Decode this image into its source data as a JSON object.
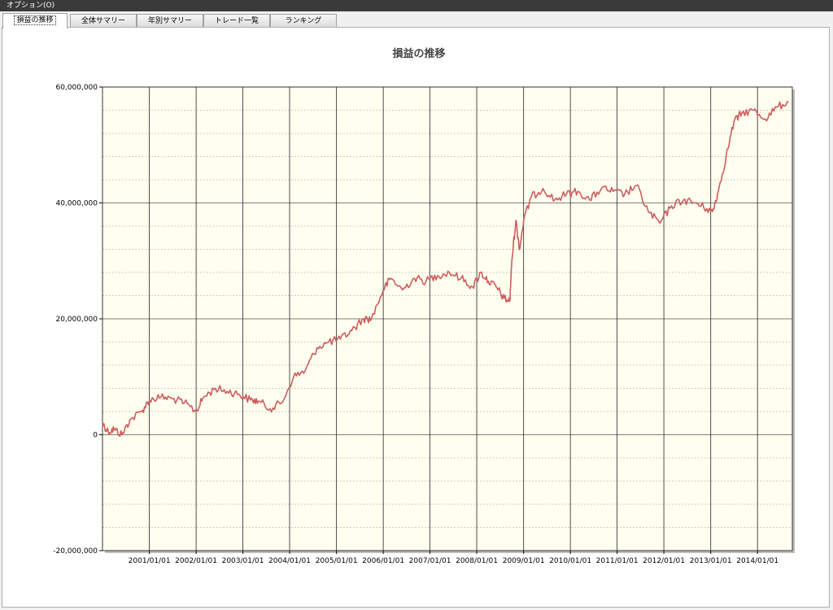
{
  "menubar": {
    "label": "オプション(O)"
  },
  "tabs": [
    {
      "label": "損益の推移",
      "active": true
    },
    {
      "label": "全体サマリー",
      "active": false
    },
    {
      "label": "年別サマリー",
      "active": false
    },
    {
      "label": "トレード一覧",
      "active": false
    },
    {
      "label": "ランキング",
      "active": false
    }
  ],
  "colors": {
    "plot_bg": "#fffff0",
    "line": "#cd5c5c",
    "grid_major": "#555555",
    "grid_minor": "#9a9a9a"
  },
  "chart_data": {
    "type": "line",
    "title": "損益の推移",
    "xlabel": "",
    "ylabel": "",
    "xlim": [
      "2000-01-01",
      "2014-09-30"
    ],
    "ylim": [
      -20000000,
      60000000
    ],
    "x_ticks": [
      "2001/01/01",
      "2002/01/01",
      "2003/01/01",
      "2004/01/01",
      "2005/01/01",
      "2006/01/01",
      "2007/01/01",
      "2008/01/01",
      "2009/01/01",
      "2010/01/01",
      "2011/01/01",
      "2012/01/01",
      "2013/01/01",
      "2014/01/01"
    ],
    "y_ticks": [
      "60,000,000",
      "40,000,000",
      "20,000,000",
      "0",
      "-20,000,000"
    ],
    "grid": true,
    "series": [
      {
        "x": [
          "2000-01-01",
          "2000-02-15",
          "2000-04-01",
          "2000-06-01",
          "2000-08-01",
          "2000-11-01",
          "2001-01-01",
          "2001-04-01",
          "2001-07-01",
          "2001-10-01",
          "2002-01-01",
          "2002-03-01",
          "2002-06-01",
          "2002-09-01",
          "2002-12-01",
          "2003-03-01",
          "2003-05-01",
          "2003-08-01",
          "2003-11-01",
          "2004-02-01",
          "2004-05-01",
          "2004-08-01",
          "2004-11-01",
          "2005-02-01",
          "2005-05-01",
          "2005-08-01",
          "2005-10-01",
          "2006-01-01",
          "2006-03-01",
          "2006-06-01",
          "2006-09-01",
          "2006-12-01",
          "2007-03-01",
          "2007-06-01",
          "2007-09-01",
          "2007-12-01",
          "2008-02-01",
          "2008-04-01",
          "2008-06-01",
          "2008-08-01",
          "2008-09-15",
          "2008-10-01",
          "2008-11-01",
          "2008-12-01",
          "2009-01-01",
          "2009-03-01",
          "2009-06-01",
          "2009-09-01",
          "2009-12-01",
          "2010-03-01",
          "2010-06-01",
          "2010-09-01",
          "2010-12-01",
          "2011-03-01",
          "2011-06-01",
          "2011-09-01",
          "2011-12-01",
          "2012-03-01",
          "2012-06-01",
          "2012-09-01",
          "2012-12-01",
          "2013-01-15",
          "2013-03-01",
          "2013-05-01",
          "2013-07-01",
          "2013-09-01",
          "2013-12-01",
          "2014-03-01",
          "2014-06-01",
          "2014-09-01"
        ],
        "y": [
          2000000,
          500000,
          1000000,
          0,
          2500000,
          4000000,
          6000000,
          6500000,
          6200000,
          5500000,
          4000000,
          6500000,
          8000000,
          7500000,
          7000000,
          6000000,
          5800000,
          4500000,
          5500000,
          10000000,
          11000000,
          15000000,
          16000000,
          16500000,
          18000000,
          20000000,
          20000000,
          25000000,
          27000000,
          25000000,
          27000000,
          26500000,
          27500000,
          28000000,
          27000000,
          25500000,
          28000000,
          26500000,
          25500000,
          23500000,
          23000000,
          30000000,
          37000000,
          32000000,
          37000000,
          41000000,
          42500000,
          40500000,
          41500000,
          42000000,
          40500000,
          42500000,
          42000000,
          41500000,
          43000000,
          38500000,
          36500000,
          39500000,
          40500000,
          40000000,
          39000000,
          38500000,
          42000000,
          48000000,
          54000000,
          55500000,
          56000000,
          54500000,
          56500000,
          57500000
        ]
      }
    ]
  }
}
